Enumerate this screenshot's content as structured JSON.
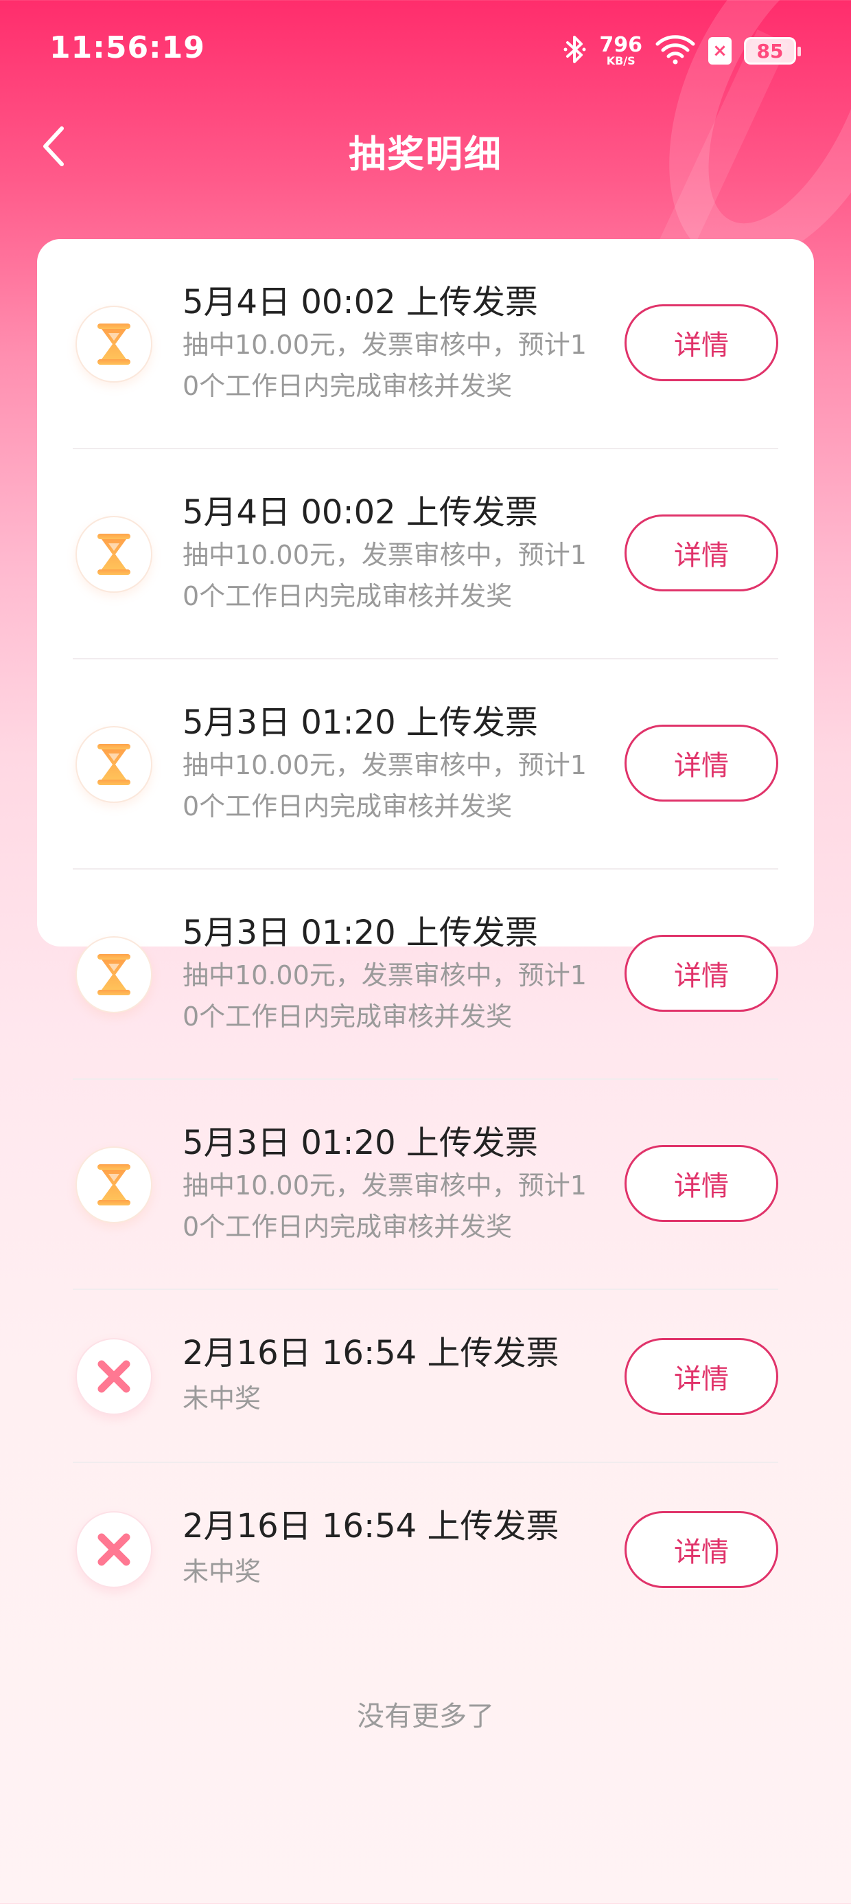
{
  "status_bar": {
    "time": "11:56:19",
    "speed_value": "796",
    "speed_unit": "KB/S",
    "sim_badge": "×",
    "battery": "85",
    "icons": [
      "bluetooth-icon",
      "wifi-icon",
      "sim-off-icon",
      "battery-icon"
    ]
  },
  "header": {
    "back_icon": "chevron-left-icon",
    "title": "抽奖明细"
  },
  "records": [
    {
      "title": "5月4日 00:02 上传发票",
      "desc": "抽中10.00元，发票审核中，预计10个工作日内完成审核并发奖",
      "status": "pending",
      "icon": "hourglass-icon",
      "button": "详情"
    },
    {
      "title": "5月4日 00:02 上传发票",
      "desc": "抽中10.00元，发票审核中，预计10个工作日内完成审核并发奖",
      "status": "pending",
      "icon": "hourglass-icon",
      "button": "详情"
    },
    {
      "title": "5月3日 01:20 上传发票",
      "desc": "抽中10.00元，发票审核中，预计10个工作日内完成审核并发奖",
      "status": "pending",
      "icon": "hourglass-icon",
      "button": "详情"
    },
    {
      "title": "5月3日 01:20 上传发票",
      "desc": "抽中10.00元，发票审核中，预计10个工作日内完成审核并发奖",
      "status": "pending",
      "icon": "hourglass-icon",
      "button": "详情"
    },
    {
      "title": "5月3日 01:20 上传发票",
      "desc": "抽中10.00元，发票审核中，预计10个工作日内完成审核并发奖",
      "status": "pending",
      "icon": "hourglass-icon",
      "button": "详情"
    },
    {
      "title": "2月16日 16:54 上传发票",
      "desc": "未中奖",
      "status": "failed",
      "icon": "cross-icon",
      "button": "详情"
    },
    {
      "title": "2月16日 16:54 上传发票",
      "desc": "未中奖",
      "status": "failed",
      "icon": "cross-icon",
      "button": "详情"
    }
  ],
  "footer": {
    "no_more": "没有更多了"
  },
  "colors": {
    "accent": "#e0336a",
    "header_gradient_top": "#ff2d6c",
    "pending_icon": "#ffae4a",
    "failed_icon": "#ff6b8a"
  }
}
